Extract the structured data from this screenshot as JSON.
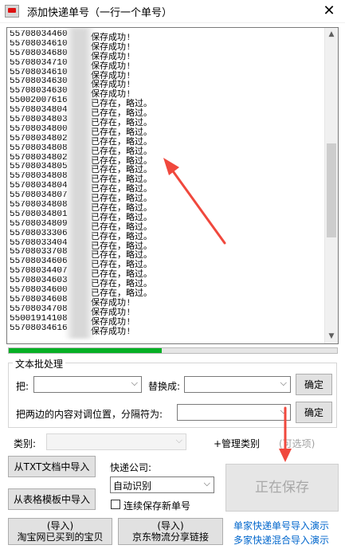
{
  "window": {
    "title": "添加快递单号（一行一个单号）",
    "close_label": "✕"
  },
  "log": {
    "lines": [
      {
        "num": "55708034460",
        "status": "保存成功!"
      },
      {
        "num": "55708034610",
        "status": "保存成功!"
      },
      {
        "num": "55708034680",
        "status": "保存成功!"
      },
      {
        "num": "55708034710",
        "status": "保存成功!"
      },
      {
        "num": "55708034610",
        "status": "保存成功!"
      },
      {
        "num": "55708034630",
        "status": "保存成功!"
      },
      {
        "num": "55708034630",
        "status": "保存成功!"
      },
      {
        "num": "55002007616",
        "status": "已存在，略过。"
      },
      {
        "num": "55708034804",
        "status": "已存在，略过。"
      },
      {
        "num": "55708034803",
        "status": "已存在，略过。"
      },
      {
        "num": "55708034800",
        "status": "已存在，略过。"
      },
      {
        "num": "55708034802",
        "status": "已存在，略过。"
      },
      {
        "num": "55708034808",
        "status": "已存在，略过。"
      },
      {
        "num": "55708034802",
        "status": "已存在，略过。"
      },
      {
        "num": "55708034805",
        "status": "已存在，略过。"
      },
      {
        "num": "55708034808",
        "status": "已存在，略过。"
      },
      {
        "num": "55708034804",
        "status": "已存在，略过。"
      },
      {
        "num": "55708034807",
        "status": "已存在，略过。"
      },
      {
        "num": "55708034808",
        "status": "已存在，略过。"
      },
      {
        "num": "55708034801",
        "status": "已存在，略过。"
      },
      {
        "num": "55708034809",
        "status": "已存在，略过。"
      },
      {
        "num": "55708033306",
        "status": "已存在，略过。"
      },
      {
        "num": "55708033404",
        "status": "已存在，略过。"
      },
      {
        "num": "55708033708",
        "status": "已存在，略过。"
      },
      {
        "num": "55708034606",
        "status": "已存在，略过。"
      },
      {
        "num": "55708034407",
        "status": "已存在，略过。"
      },
      {
        "num": "55708034603",
        "status": "已存在，略过。"
      },
      {
        "num": "55708034600",
        "status": "已存在，略过。"
      },
      {
        "num": "55708034608",
        "status": "保存成功!"
      },
      {
        "num": "55708034708",
        "status": "保存成功!"
      },
      {
        "num": "55001914108",
        "status": "保存成功!"
      },
      {
        "num": "55708034616",
        "status": "保存成功!"
      }
    ],
    "scroll_up": "▲",
    "scroll_down": "▼"
  },
  "progress": {
    "value": 0.465,
    "color": "#06b025"
  },
  "batch": {
    "title": "文本批处理",
    "replace_from_label": "把:",
    "replace_to_label": "替换成:",
    "confirm_replace": "确定",
    "swap_label": "把两边的内容对调位置，分隔符为:",
    "confirm_swap": "确定"
  },
  "category": {
    "label": "类别:",
    "manage": "+管理类别",
    "optional": "(可选项)"
  },
  "import": {
    "txt_button": "从TXT文档中导入",
    "template_button": "从表格模板中导入",
    "taobao_line1": "(导入)",
    "taobao_line2": "淘宝网已买到的宝贝",
    "jd_line1": "(导入)",
    "jd_line2": "京东物流分享链接"
  },
  "courier": {
    "label": "快递公司:",
    "selected": "自动识别"
  },
  "continuous": {
    "label": "连续保存新单号",
    "checked": false
  },
  "save_button": "正在保存",
  "links": {
    "single": "单家快递单号导入演示",
    "multi": "多家快递混合导入演示"
  },
  "icons": {
    "combo_arrow": "chevron-down-icon",
    "close": "close-icon",
    "app": "app-icon"
  },
  "colors": {
    "accent_link": "#0066cc",
    "annotation_arrow": "#f0483d"
  }
}
